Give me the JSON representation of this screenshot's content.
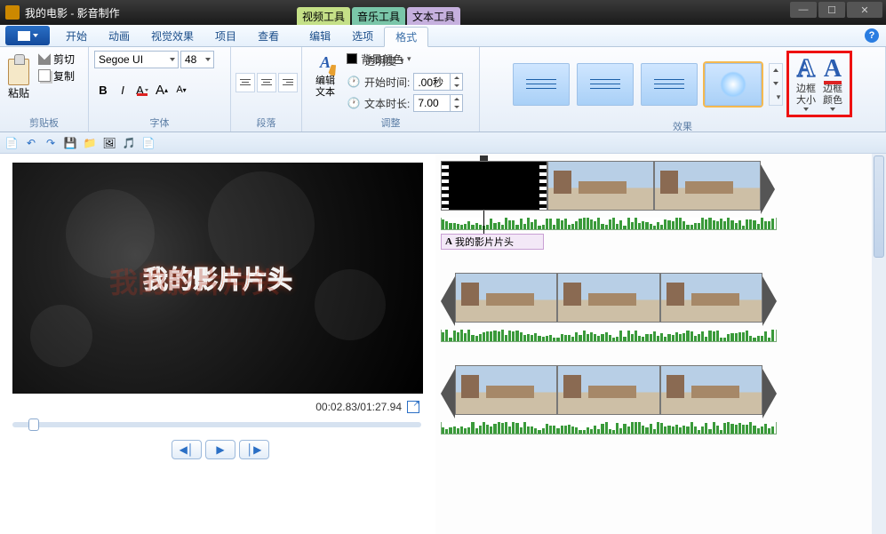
{
  "title": "我的电影 - 影音制作",
  "context_tabs": {
    "video": "视频工具",
    "music": "音乐工具",
    "text": "文本工具"
  },
  "tabs": {
    "home": "开始",
    "anim": "动画",
    "vfx": "视觉效果",
    "project": "项目",
    "view": "查看",
    "edit": "编辑",
    "options": "选项",
    "format": "格式"
  },
  "clipboard": {
    "group": "剪贴板",
    "paste": "粘贴",
    "cut": "剪切",
    "copy": "复制"
  },
  "font": {
    "group": "字体",
    "name": "Segoe UI",
    "size": "48",
    "bold": "B",
    "italic": "I",
    "color": "A",
    "grow": "A",
    "shrink": "A"
  },
  "paragraph": {
    "group": "段落"
  },
  "edit_text": {
    "label": "编辑\n文本"
  },
  "adjust": {
    "group": "调整",
    "transparency": "透明度",
    "bgcolor": "背景颜色",
    "start_lbl": "开始时间:",
    "start_val": ".00秒",
    "dur_lbl": "文本时长:",
    "dur_val": "7.00"
  },
  "effects": {
    "group": "效果"
  },
  "outline": {
    "size": "边框\n大小",
    "color": "边框\n颜色"
  },
  "timecode": "00:02.83/01:27.94",
  "caption_text": "我的影片片头",
  "preview_text": "我的影片片头"
}
